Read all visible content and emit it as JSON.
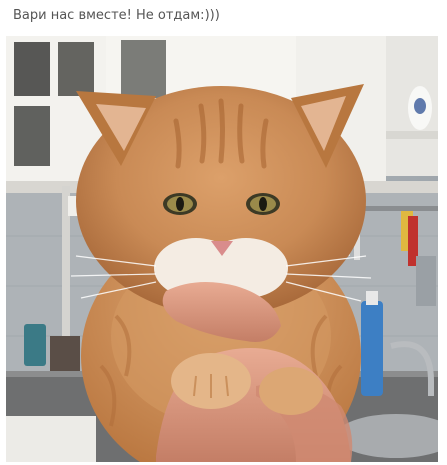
{
  "post": {
    "caption": "Вари нас вместе! Не отдам:)))"
  },
  "photo": {
    "subject": "ginger-kitten"
  },
  "colors": {
    "caption_text": "#555555",
    "fur_main": "#c98a55",
    "fur_light": "#e2b483",
    "fur_dark": "#a8693a",
    "muzzle_white": "#f4ece3",
    "hand_skin": "#e2a08a",
    "wall_light": "#eceae6",
    "cabinet_white": "#f3f2ee",
    "counter_gray": "#6e6f70",
    "tile_gray": "#b8bcc0"
  }
}
